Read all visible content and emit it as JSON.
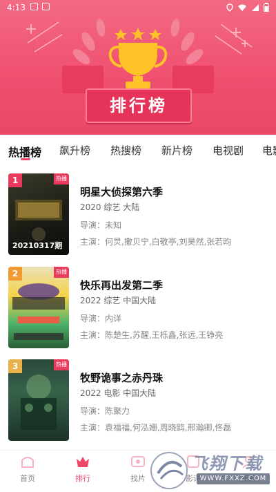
{
  "status_bar": {
    "time": "4:13"
  },
  "banner": {
    "title": "排行榜"
  },
  "tabs": [
    {
      "label": "热播榜",
      "active": true
    },
    {
      "label": "飙升榜"
    },
    {
      "label": "热搜榜"
    },
    {
      "label": "新片榜"
    },
    {
      "label": "电视剧"
    },
    {
      "label": "电影"
    }
  ],
  "items": [
    {
      "rank": "1",
      "tag": "热播",
      "badge": "20210317期",
      "title": "明星大侦探第六季",
      "meta": "2020  综艺  大陆",
      "director": "导演：未知",
      "cast": "主演：何炅,撒贝宁,白敬亭,刘昊然,张若昀"
    },
    {
      "rank": "2",
      "tag": "热播",
      "badge": "",
      "title": "快乐再出发第二季",
      "meta": "2022  综艺  中国大陆",
      "director": "导演：内详",
      "cast": "主演：陈楚生,苏醒,王栎鑫,张远,王铮亮"
    },
    {
      "rank": "3",
      "tag": "热播",
      "badge": "",
      "title": "牧野诡事之赤丹珠",
      "meta": "2022  电影  中国大陆",
      "director": "导演：陈聚力",
      "cast": "主演：袁福福,何泓姗,周晓鸥,邢瀚卿,佟磊"
    }
  ],
  "nav": [
    {
      "label": "首页",
      "icon": "home-icon"
    },
    {
      "label": "排行",
      "icon": "ranking-icon",
      "active": true
    },
    {
      "label": "找片",
      "icon": "find-icon"
    },
    {
      "label": "影评",
      "icon": "review-icon"
    },
    {
      "label": "我的",
      "icon": "profile-icon"
    }
  ],
  "watermark": {
    "name": "飞翔下载",
    "url": "WWW.FXXZ.COM"
  },
  "colors": {
    "accent": "#ee4868",
    "banner": "#ef4f6e"
  }
}
